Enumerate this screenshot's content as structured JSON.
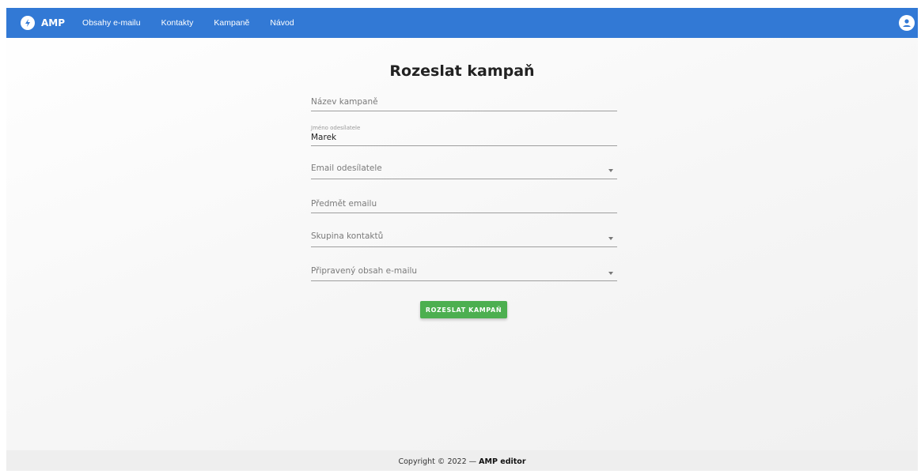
{
  "navbar": {
    "brand": "AMP",
    "brand_icon": "bolt-icon",
    "links": [
      "Obsahy e-mailu",
      "Kontakty",
      "Kampaně",
      "Návod"
    ],
    "user_icon": "account-circle-icon",
    "color": "#3279d5"
  },
  "form": {
    "title": "Rozeslat kampaň",
    "campaign_name": {
      "placeholder": "Název kampaně",
      "value": ""
    },
    "sender_name": {
      "label": "Jméno odesílatele",
      "value": "Marek"
    },
    "sender_email": {
      "placeholder": "Email odesílatele",
      "value": ""
    },
    "subject": {
      "placeholder": "Předmět emailu",
      "value": ""
    },
    "contact_group": {
      "placeholder": "Skupina kontaktů",
      "value": ""
    },
    "prepared_content": {
      "placeholder": "Připravený obsah e-mailu",
      "value": ""
    },
    "submit_label": "ROZESLAT KAMPAŇ",
    "submit_color": "#4caf50"
  },
  "footer": {
    "prefix": "Copyright © 2022 — ",
    "brand": "AMP editor"
  }
}
